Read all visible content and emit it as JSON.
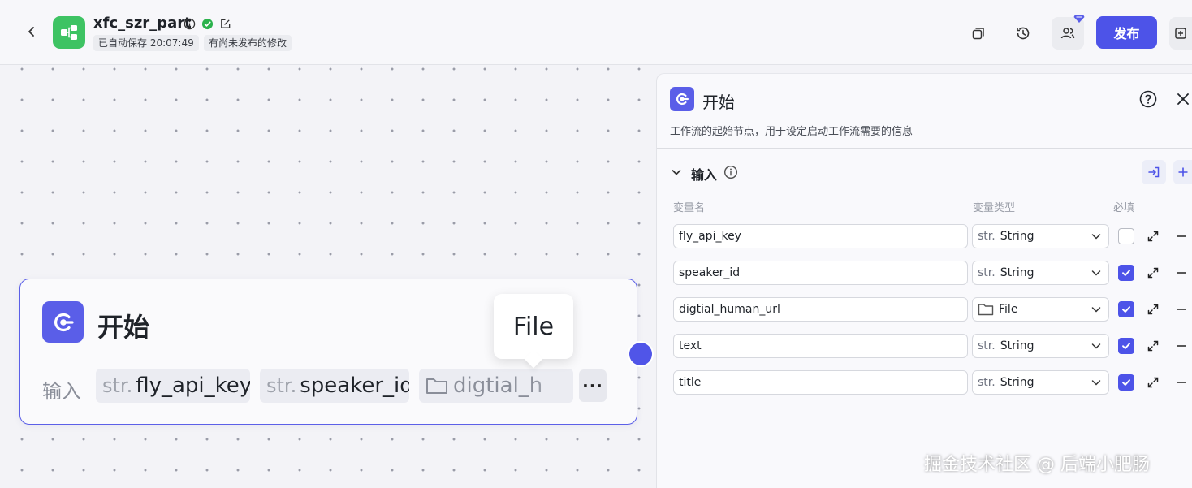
{
  "header": {
    "app_name": "xfc_szr_part",
    "autosave_text": "已自动保存 20:07:49",
    "unpublished_text": "有尚未发布的修改",
    "publish_label": "发布",
    "brand_color": "#4d53e8",
    "app_icon_color": "#3ec363"
  },
  "canvas": {
    "node": {
      "title": "开始",
      "input_label": "输入",
      "chips": [
        {
          "type": "str.",
          "name": "fly_api_key"
        },
        {
          "type": "str.",
          "name": "speaker_id"
        },
        {
          "type": "file-icon",
          "name": "digtial_h"
        }
      ],
      "more_label": "···"
    },
    "tooltip": "File"
  },
  "panel": {
    "title": "开始",
    "description": "工作流的起始节点，用于设定启动工作流需要的信息",
    "section_title": "输入",
    "columns": {
      "name": "变量名",
      "type": "变量类型",
      "required": "必填"
    },
    "rows": [
      {
        "name": "fly_api_key",
        "type_prefix": "str.",
        "type": "String",
        "required": false
      },
      {
        "name": "speaker_id",
        "type_prefix": "str.",
        "type": "String",
        "required": true
      },
      {
        "name": "digtial_human_url",
        "type_prefix": "folder-icon",
        "type": "File",
        "required": true
      },
      {
        "name": "text",
        "type_prefix": "str.",
        "type": "String",
        "required": true
      },
      {
        "name": "title",
        "type_prefix": "str.",
        "type": "String",
        "required": true
      }
    ]
  },
  "watermark": "掘金技术社区 @ 后端小肥肠"
}
